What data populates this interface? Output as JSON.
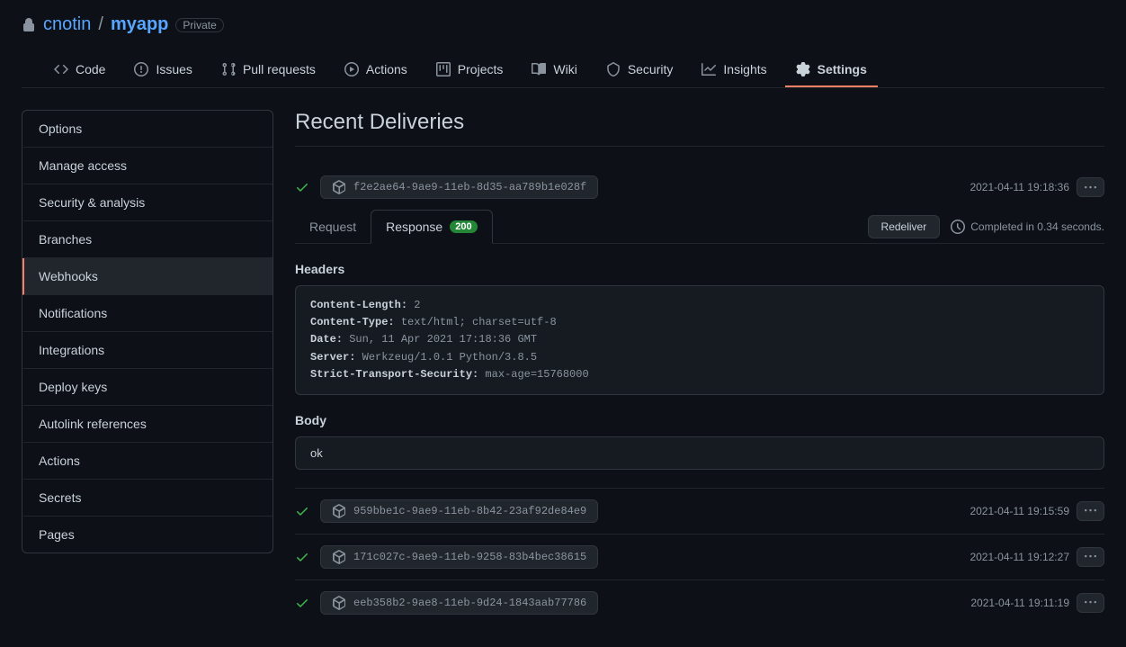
{
  "repo": {
    "owner": "cnotin",
    "name": "myapp",
    "visibility": "Private"
  },
  "nav": {
    "code": "Code",
    "issues": "Issues",
    "pulls": "Pull requests",
    "actions": "Actions",
    "projects": "Projects",
    "wiki": "Wiki",
    "security": "Security",
    "insights": "Insights",
    "settings": "Settings"
  },
  "sidebar": {
    "options": "Options",
    "manage_access": "Manage access",
    "security_analysis": "Security & analysis",
    "branches": "Branches",
    "webhooks": "Webhooks",
    "notifications": "Notifications",
    "integrations": "Integrations",
    "deploy_keys": "Deploy keys",
    "autolink": "Autolink references",
    "actions": "Actions",
    "secrets": "Secrets",
    "pages": "Pages"
  },
  "page": {
    "title": "Recent Deliveries",
    "tabs": {
      "request": "Request",
      "response": "Response",
      "status": "200"
    },
    "redeliver": "Redeliver",
    "completed": "Completed in 0.34 seconds.",
    "headers_title": "Headers",
    "body_title": "Body",
    "body_content": "ok",
    "headers": [
      {
        "k": "Content-Length:",
        "v": " 2"
      },
      {
        "k": "Content-Type:",
        "v": " text/html; charset=utf-8"
      },
      {
        "k": "Date:",
        "v": " Sun, 11 Apr 2021 17:18:36 GMT"
      },
      {
        "k": "Server:",
        "v": " Werkzeug/1.0.1 Python/3.8.5"
      },
      {
        "k": "Strict-Transport-Security:",
        "v": " max-age=15768000"
      }
    ]
  },
  "deliveries": [
    {
      "id": "f2e2ae64-9ae9-11eb-8d35-aa789b1e028f",
      "time": "2021-04-11 19:18:36"
    },
    {
      "id": "959bbe1c-9ae9-11eb-8b42-23af92de84e9",
      "time": "2021-04-11 19:15:59"
    },
    {
      "id": "171c027c-9ae9-11eb-9258-83b4bec38615",
      "time": "2021-04-11 19:12:27"
    },
    {
      "id": "eeb358b2-9ae8-11eb-9d24-1843aab77786",
      "time": "2021-04-11 19:11:19"
    }
  ]
}
